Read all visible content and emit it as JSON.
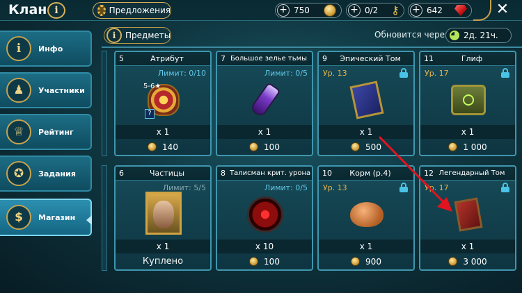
{
  "header": {
    "title": "Клан",
    "info_icon": "info-icon",
    "offers_label": "Предложения",
    "resources": [
      {
        "name": "coins",
        "value": "750",
        "icon": "coin-icon"
      },
      {
        "name": "keys",
        "value": "0/2",
        "icon": "key-icon"
      },
      {
        "name": "gems",
        "value": "642",
        "icon": "gem-icon"
      }
    ],
    "close_icon": "close-icon"
  },
  "sidebar": {
    "items": [
      {
        "label": "Инфо",
        "icon": "info-icon",
        "glyph": "i"
      },
      {
        "label": "Участники",
        "icon": "members-icon",
        "glyph": "♟"
      },
      {
        "label": "Рейтинг",
        "icon": "trophy-icon",
        "glyph": "♕"
      },
      {
        "label": "Задания",
        "icon": "medal-icon",
        "glyph": "✪"
      },
      {
        "label": "Магазин",
        "icon": "bag-icon",
        "glyph": "$",
        "active": true
      }
    ]
  },
  "shop": {
    "tab_label": "Предметы",
    "refresh_label": "Обновится через:",
    "refresh_time": "2д. 21ч.",
    "cards": [
      {
        "num": "5",
        "name": "Атрибут",
        "limit": "Лимит: 0/10",
        "qty": "x 1",
        "price": "140",
        "badge": "5-6★"
      },
      {
        "num": "7",
        "name": "Большое зелье тьмы",
        "limit": "Лимит: 0/5",
        "qty": "x 1",
        "price": "100"
      },
      {
        "num": "9",
        "name": "Эпический Том",
        "level": "Ур. 13",
        "qty": "x 1",
        "price": "500"
      },
      {
        "num": "11",
        "name": "Глиф",
        "level": "Ур. 17",
        "qty": "x 1",
        "price": "1 000"
      },
      {
        "num": "6",
        "name": "Частицы",
        "limit": "Лимит: 5/5",
        "qty": "x 1",
        "status": "Куплено"
      },
      {
        "num": "8",
        "name": "Талисман крит. урона",
        "limit": "Лимит: 0/5",
        "qty": "x 10",
        "price": "100"
      },
      {
        "num": "10",
        "name": "Корм (р.4)",
        "level": "Ур. 13",
        "qty": "x 1",
        "price": "900"
      },
      {
        "num": "12",
        "name": "Легендарный Том",
        "level": "Ур. 17",
        "qty": "x 1",
        "price": "3 000"
      }
    ]
  },
  "colors": {
    "accent_gold": "#d6b15a",
    "limit_blue": "#5fc8e8",
    "level_orange": "#e8b64e",
    "arrow_red": "#e0141e"
  }
}
